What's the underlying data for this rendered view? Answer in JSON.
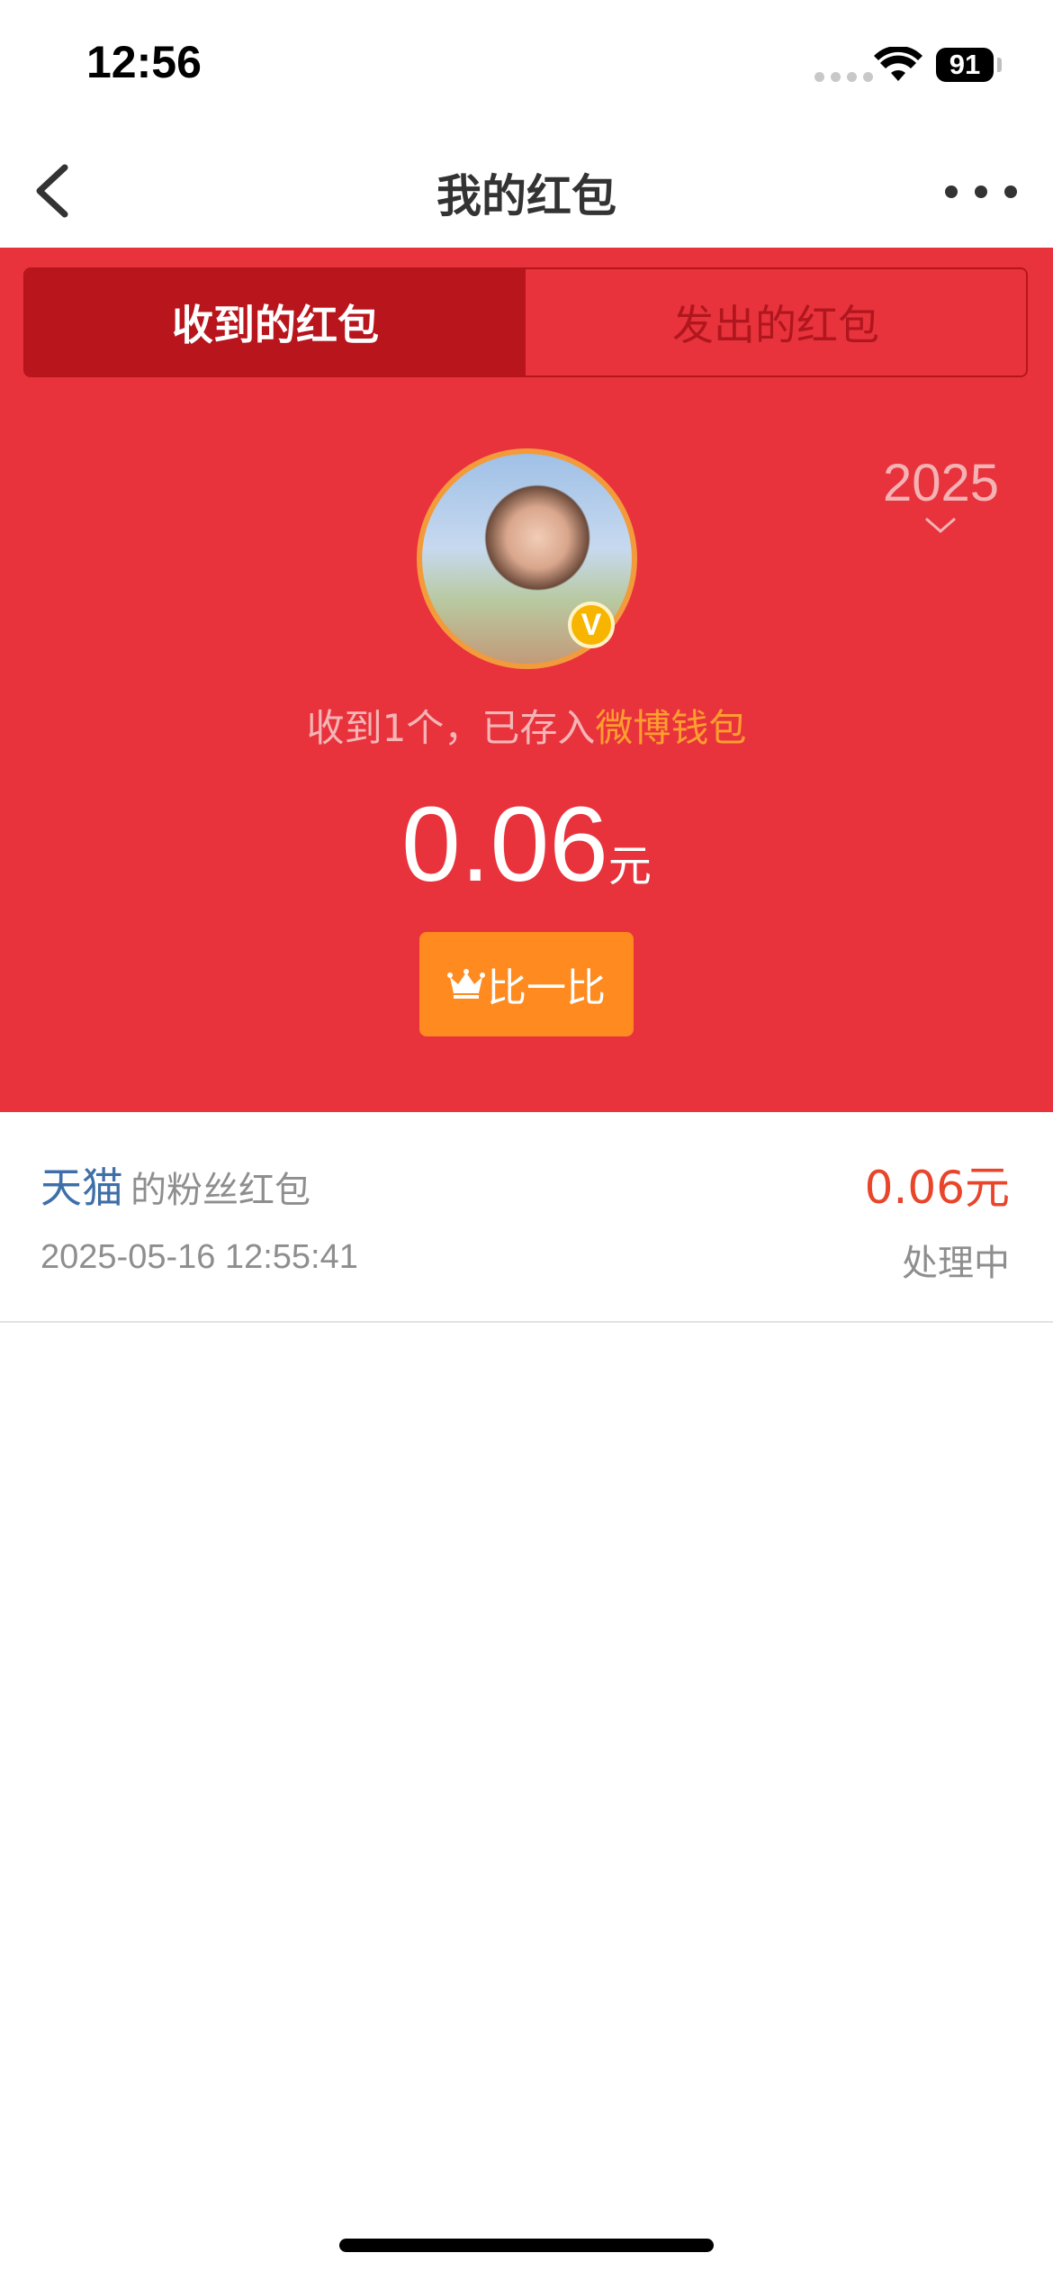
{
  "status_bar": {
    "time": "12:56",
    "battery": "91"
  },
  "nav": {
    "title": "我的红包",
    "back_icon": "chevron-left-icon",
    "more_icon": "ellipsis-icon"
  },
  "tabs": [
    {
      "label": "收到的红包",
      "active": true
    },
    {
      "label": "发出的红包",
      "active": false
    }
  ],
  "year_selector": {
    "value": "2025",
    "icon": "chevron-down-icon"
  },
  "summary": {
    "received_prefix": "收到1个，已存入",
    "wallet_link": "微博钱包",
    "amount": "0.06",
    "unit": "元",
    "verified_badge": "V"
  },
  "compare_button": {
    "label": "比一比",
    "icon": "crown-icon"
  },
  "records": [
    {
      "sender": "天猫",
      "type": "的粉丝红包",
      "time": "2025-05-16 12:55:41",
      "amount": "0.06元",
      "status": "处理中"
    }
  ],
  "colors": {
    "hero_red": "#e8333d",
    "tab_active": "#b8151c",
    "accent_orange": "#ff8a1f",
    "link_orange": "#ff9d2e",
    "sender_blue": "#3f6fa8",
    "amount_red": "#e8452a"
  }
}
